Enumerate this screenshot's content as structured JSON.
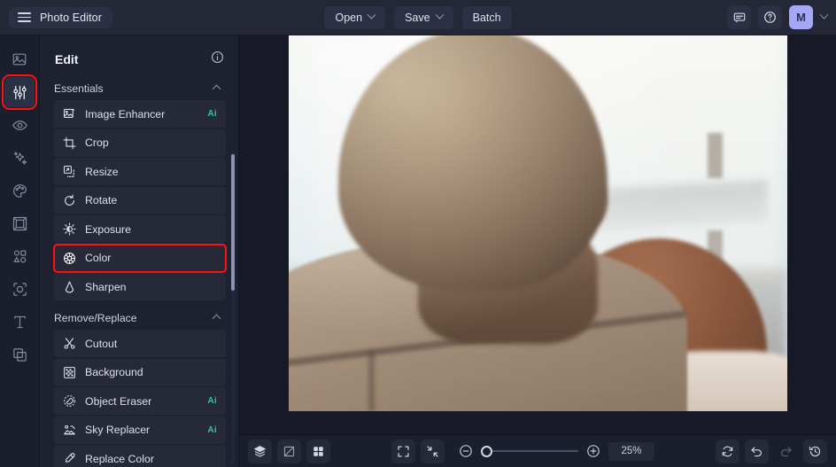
{
  "app": {
    "title": "Photo Editor",
    "accent_purple": "#a5a8f8",
    "ai_badge_color": "#35c49a",
    "highlight_color": "#ff1111",
    "panel_bg": "#1e2130",
    "topbar_bg": "#232736"
  },
  "topbar": {
    "menu_icon": "hamburger-icon",
    "open_label": "Open",
    "save_label": "Save",
    "batch_label": "Batch",
    "feedback_icon": "comment-icon",
    "help_icon": "help-circle-icon",
    "avatar_initial": "M"
  },
  "rail": {
    "items": [
      {
        "icon": "image-icon",
        "name": "image",
        "active": false
      },
      {
        "icon": "sliders-icon",
        "name": "adjust",
        "active": true,
        "highlighted": true
      },
      {
        "icon": "eye-icon",
        "name": "retouch",
        "active": false
      },
      {
        "icon": "sparkles-icon",
        "name": "effects",
        "active": false
      },
      {
        "icon": "palette-icon",
        "name": "color-palette",
        "active": false
      },
      {
        "icon": "frame-icon",
        "name": "frames",
        "active": false
      },
      {
        "icon": "shapes-icon",
        "name": "shapes",
        "active": false
      },
      {
        "icon": "crop-overlay-icon",
        "name": "overlay",
        "active": false
      },
      {
        "icon": "text-icon",
        "name": "text",
        "active": false
      },
      {
        "icon": "layers-stack-icon",
        "name": "layers",
        "active": false
      }
    ]
  },
  "panel": {
    "title": "Edit",
    "info_icon": "info-circle-icon",
    "sections": [
      {
        "title": "Essentials",
        "collapse_icon": "chevron-up-icon",
        "items": [
          {
            "label": "Image Enhancer",
            "icon": "image-enhance-icon",
            "badge": "Ai",
            "selected": false
          },
          {
            "label": "Crop",
            "icon": "crop-icon",
            "badge": "",
            "selected": false
          },
          {
            "label": "Resize",
            "icon": "resize-icon",
            "badge": "",
            "selected": false
          },
          {
            "label": "Rotate",
            "icon": "rotate-icon",
            "badge": "",
            "selected": false
          },
          {
            "label": "Exposure",
            "icon": "exposure-icon",
            "badge": "",
            "selected": false
          },
          {
            "label": "Color",
            "icon": "color-wheel-icon",
            "badge": "",
            "selected": true
          },
          {
            "label": "Sharpen",
            "icon": "sharpen-icon",
            "badge": "",
            "selected": false
          }
        ]
      },
      {
        "title": "Remove/Replace",
        "collapse_icon": "chevron-up-icon",
        "items": [
          {
            "label": "Cutout",
            "icon": "scissors-icon",
            "badge": "",
            "selected": false
          },
          {
            "label": "Background",
            "icon": "checkerboard-icon",
            "badge": "",
            "selected": false
          },
          {
            "label": "Object Eraser",
            "icon": "eraser-icon",
            "badge": "Ai",
            "selected": false
          },
          {
            "label": "Sky Replacer",
            "icon": "sky-icon",
            "badge": "Ai",
            "selected": false
          },
          {
            "label": "Replace Color",
            "icon": "eyedropper-icon",
            "badge": "",
            "selected": false
          }
        ]
      }
    ]
  },
  "canvas": {
    "image_alt": "Couple embracing outdoors, warm faded tone"
  },
  "bottombar": {
    "left_buttons": [
      {
        "icon": "layers-icon",
        "name": "layers-toggle"
      },
      {
        "icon": "compare-icon",
        "name": "compare-toggle"
      },
      {
        "icon": "grid-icon",
        "name": "grid-toggle"
      }
    ],
    "center_buttons": [
      {
        "icon": "fit-screen-icon",
        "name": "fit-to-screen"
      },
      {
        "icon": "actual-size-icon",
        "name": "actual-size"
      }
    ],
    "zoom_out_icon": "zoom-out-icon",
    "zoom_in_icon": "zoom-in-icon",
    "zoom_value": "25%",
    "right_buttons": [
      {
        "icon": "reset-icon",
        "name": "reset-button",
        "disabled": false
      },
      {
        "icon": "undo-icon",
        "name": "undo-button",
        "disabled": false
      },
      {
        "icon": "redo-icon",
        "name": "redo-button",
        "disabled": true
      },
      {
        "icon": "history-icon",
        "name": "history-button",
        "disabled": false
      }
    ]
  }
}
